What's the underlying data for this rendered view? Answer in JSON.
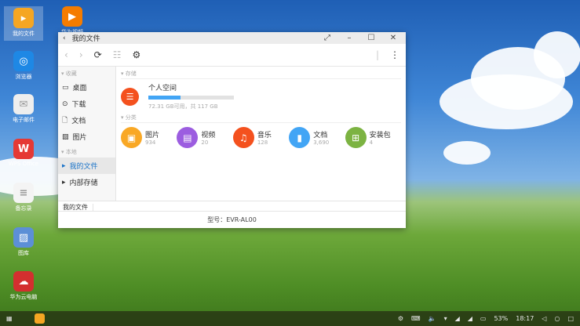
{
  "desktop": {
    "icons": [
      {
        "label": "我的文件",
        "color": "#f5a623",
        "glyph": "folder-icon"
      },
      {
        "label": "浏览器",
        "color": "#1e88e5",
        "glyph": "browser-icon"
      },
      {
        "label": "电子邮件",
        "color": "#eeeeee",
        "glyph": "mail-icon"
      },
      {
        "label": "WPS Office",
        "color": "#e53935",
        "glyph": "wps-icon"
      },
      {
        "label": "备忘录",
        "color": "#f4f4f4",
        "glyph": "notes-icon"
      },
      {
        "label": "图库",
        "color": "#5c8fd6",
        "glyph": "gallery-icon"
      },
      {
        "label": "华为云电脑",
        "color": "#d32f2f",
        "glyph": "cloud-pc-icon"
      },
      {
        "label": "华为视频",
        "color": "#f57c00",
        "glyph": "video-icon"
      }
    ]
  },
  "window": {
    "title": "我的文件",
    "sidebar": {
      "favorites_label": "收藏",
      "favorites": [
        "桌面",
        "下载",
        "文档",
        "图片"
      ],
      "local_label": "本地",
      "local": [
        "我的文件",
        "内部存储"
      ]
    },
    "storage": {
      "section": "存储",
      "name": "个人空间",
      "usage_fraction": 0.38,
      "detail": "72.31 GB可用，共 117 GB"
    },
    "categories": {
      "section": "分类",
      "items": [
        {
          "label": "图片",
          "count": "934",
          "color": "#f9a825"
        },
        {
          "label": "视频",
          "count": "20",
          "color": "#9c5de0"
        },
        {
          "label": "音乐",
          "count": "128",
          "color": "#f4511e"
        },
        {
          "label": "文档",
          "count": "3,690",
          "color": "#42a5f5"
        },
        {
          "label": "安装包",
          "count": "4",
          "color": "#7cb342"
        }
      ]
    },
    "breadcrumb": "我的文件",
    "footer": "型号：EVR-AL00"
  },
  "taskbar": {
    "battery": "53%",
    "time": "18:17"
  }
}
